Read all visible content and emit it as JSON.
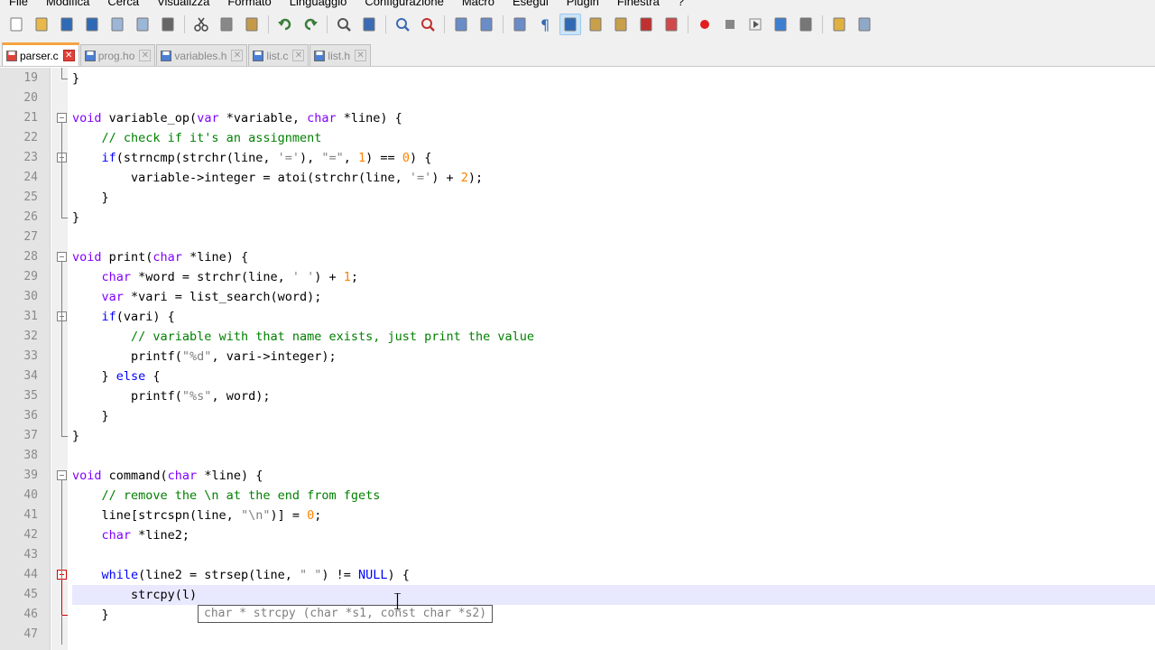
{
  "menu": [
    "File",
    "Modifica",
    "Cerca",
    "Visualizza",
    "Formato",
    "Linguaggio",
    "Configurazione",
    "Macro",
    "Esegui",
    "Plugin",
    "Finestra",
    "?"
  ],
  "toolbar": {
    "icons": [
      "new-file-icon",
      "open-file-icon",
      "save-icon",
      "save-all-icon",
      "close-icon",
      "close-all-icon",
      "print-icon",
      "cut-icon",
      "copy-icon",
      "paste-icon",
      "undo-icon",
      "redo-icon",
      "find-icon",
      "replace-icon",
      "zoom-in-icon",
      "zoom-out-icon",
      "sync-vertical-icon",
      "sync-horizontal-icon",
      "word-wrap-icon",
      "show-all-chars-icon",
      "indent-guide-icon",
      "user-defined-icon",
      "doc-map-icon",
      "function-list-icon",
      "folder-as-workspace-icon",
      "record-macro-icon",
      "stop-macro-icon",
      "play-macro-icon",
      "run-macro-multiple-icon",
      "save-macro-icon",
      "open-folder-icon",
      "spell-check-icon"
    ]
  },
  "tabs": [
    {
      "label": "parser.c",
      "active": true,
      "color": "#e0413a"
    },
    {
      "label": "prog.ho",
      "active": false,
      "color": "#4a7fd4"
    },
    {
      "label": "variables.h",
      "active": false,
      "color": "#4a7fd4"
    },
    {
      "label": "list.c",
      "active": false,
      "color": "#4a7fd4"
    },
    {
      "label": "list.h",
      "active": false,
      "color": "#4a7fd4"
    }
  ],
  "editor": {
    "current_line": 45,
    "lines": [
      {
        "n": "19",
        "text": "}"
      },
      {
        "n": "20",
        "text": ""
      },
      {
        "n": "21",
        "text": "void variable_op(var *variable, char *line) {"
      },
      {
        "n": "22",
        "text": "    // check if it's an assignment"
      },
      {
        "n": "23",
        "text": "    if(strncmp(strchr(line, '='), \"=\", 1) == 0) {"
      },
      {
        "n": "24",
        "text": "        variable->integer = atoi(strchr(line, '=') + 2);"
      },
      {
        "n": "25",
        "text": "    }"
      },
      {
        "n": "26",
        "text": "}"
      },
      {
        "n": "27",
        "text": ""
      },
      {
        "n": "28",
        "text": "void print(char *line) {"
      },
      {
        "n": "29",
        "text": "    char *word = strchr(line, ' ') + 1;"
      },
      {
        "n": "30",
        "text": "    var *vari = list_search(word);"
      },
      {
        "n": "31",
        "text": "    if(vari) {"
      },
      {
        "n": "32",
        "text": "        // variable with that name exists, just print the value"
      },
      {
        "n": "33",
        "text": "        printf(\"%d\", vari->integer);"
      },
      {
        "n": "34",
        "text": "    } else {"
      },
      {
        "n": "35",
        "text": "        printf(\"%s\", word);"
      },
      {
        "n": "36",
        "text": "    }"
      },
      {
        "n": "37",
        "text": "}"
      },
      {
        "n": "38",
        "text": ""
      },
      {
        "n": "39",
        "text": "void command(char *line) {"
      },
      {
        "n": "40",
        "text": "    // remove the \\n at the end from fgets"
      },
      {
        "n": "41",
        "text": "    line[strcspn(line, \"\\n\")] = 0;"
      },
      {
        "n": "42",
        "text": "    char *line2;"
      },
      {
        "n": "43",
        "text": ""
      },
      {
        "n": "44",
        "text": "    while(line2 = strsep(line, \" \") != NULL) {"
      },
      {
        "n": "45",
        "text": "        strcpy(l)"
      },
      {
        "n": "46",
        "text": "    }"
      },
      {
        "n": "47",
        "text": ""
      }
    ]
  },
  "calltip": {
    "text": "char * strcpy (char *s1, const char *s2)"
  }
}
